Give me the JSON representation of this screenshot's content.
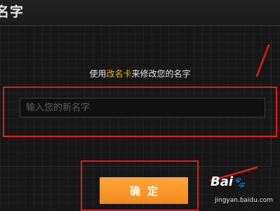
{
  "dialog": {
    "title": "名字",
    "instruction_prefix": "使用",
    "instruction_highlight": "改名卡",
    "instruction_suffix": "来修改您的名字",
    "input_placeholder": "输入您的新名字",
    "confirm_label": "确定"
  },
  "watermark": {
    "logo_text": "Bai",
    "logo_paw": "🐾",
    "logo_tail": "",
    "url": "jingyan.baidu.com"
  },
  "colors": {
    "accent_orange": "#f28a1e",
    "highlight_yellow": "#f2b500",
    "annotation_red": "#e21a1a"
  }
}
